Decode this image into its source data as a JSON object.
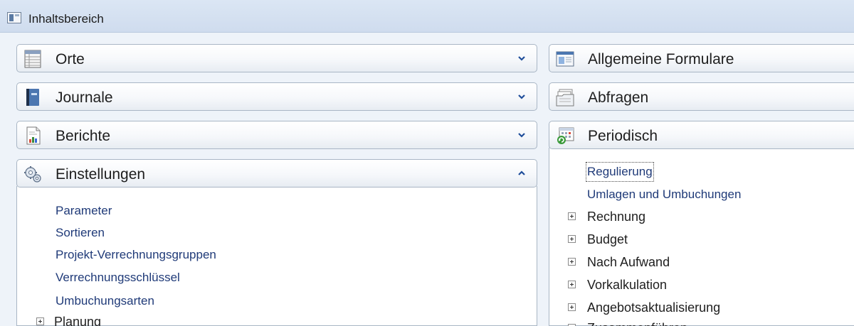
{
  "window": {
    "title": "Inhaltsbereich"
  },
  "left_panels": {
    "orte": {
      "label": "Orte"
    },
    "journale": {
      "label": "Journale"
    },
    "berichte": {
      "label": "Berichte"
    },
    "einstellungen": {
      "label": "Einstellungen",
      "links": [
        {
          "label": "Parameter",
          "highlighted": true
        },
        {
          "label": "Sortieren",
          "highlighted": false
        },
        {
          "label": "Projekt-Verrechnungsgruppen",
          "highlighted": true
        },
        {
          "label": "Verrechnungsschlüssel",
          "highlighted": true
        },
        {
          "label": "Umbuchungsarten",
          "highlighted": true
        }
      ],
      "tree": [
        {
          "label": "Planung"
        }
      ]
    }
  },
  "right_panels": {
    "allgemeine_formulare": {
      "label": "Allgemeine Formulare"
    },
    "abfragen": {
      "label": "Abfragen"
    },
    "periodisch": {
      "label": "Periodisch",
      "links": [
        {
          "label": "Regulierung",
          "highlighted": false,
          "focused": true
        },
        {
          "label": "Umlagen und Umbuchungen",
          "highlighted": true
        }
      ],
      "tree": [
        {
          "label": "Rechnung"
        },
        {
          "label": "Budget"
        },
        {
          "label": "Nach Aufwand"
        },
        {
          "label": "Vorkalkulation"
        },
        {
          "label": "Angebotsaktualisierung"
        },
        {
          "label": "Zusammenführen"
        }
      ]
    }
  },
  "colors": {
    "highlight": "#ffff22",
    "link": "#1f3a78",
    "accent": "#1f4e9a"
  }
}
